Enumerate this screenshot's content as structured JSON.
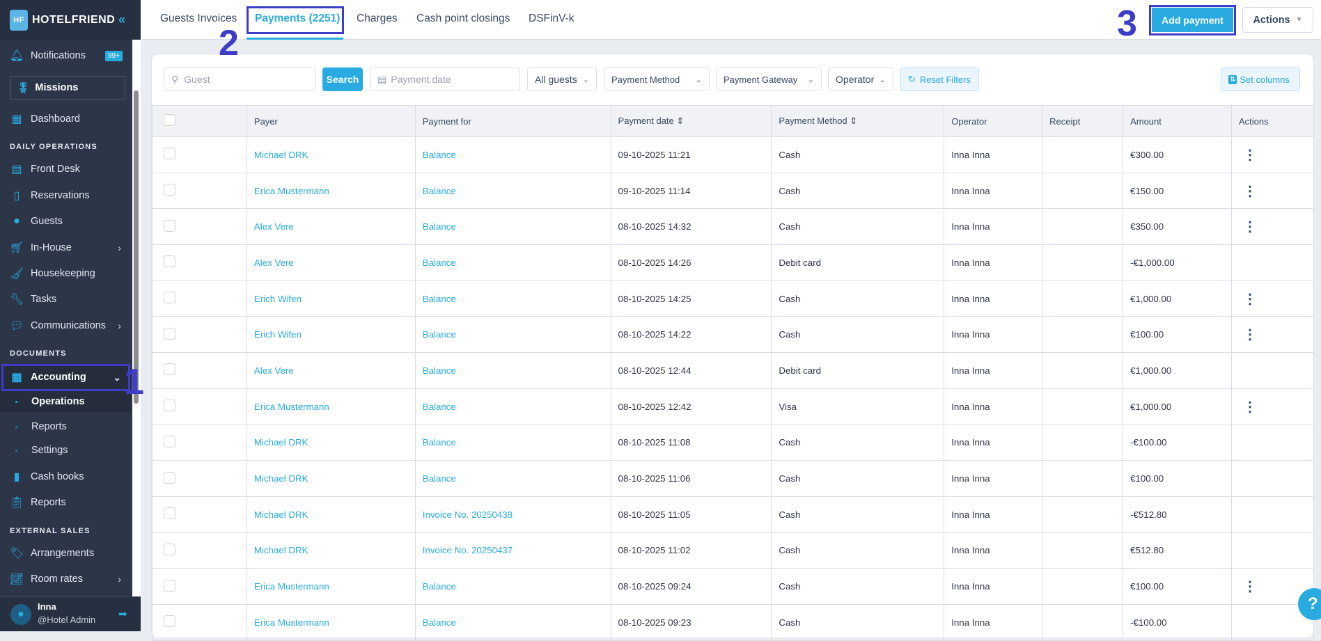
{
  "app": {
    "brand": "HOTELFRIEND",
    "logo_letters": "HF"
  },
  "sidebar": {
    "notifications": "Notifications",
    "notif_badge": "99+",
    "missions": "Missions",
    "dashboard": "Dashboard",
    "section_daily": "DAILY OPERATIONS",
    "daily": [
      "Front Desk",
      "Reservations",
      "Guests",
      "In-House",
      "Housekeeping",
      "Tasks",
      "Communications"
    ],
    "section_documents": "DOCUMENTS",
    "accounting": "Accounting",
    "accounting_sub": [
      "Operations",
      "Reports",
      "Settings"
    ],
    "docs": [
      "Cash books",
      "Reports"
    ],
    "section_external": "EXTERNAL SALES",
    "external": [
      "Arrangements",
      "Room rates"
    ],
    "user": {
      "name": "Inna",
      "role": "@Hotel Admin"
    }
  },
  "annotations": [
    "1",
    "2",
    "3"
  ],
  "tabs": [
    "Guests Invoices",
    "Payments (2251)",
    "Charges",
    "Cash point closings",
    "DSFinV-k"
  ],
  "toolbar": {
    "add_payment": "Add payment",
    "actions": "Actions"
  },
  "filters": {
    "guest_placeholder": "Guest",
    "search": "Search",
    "date_placeholder": "Payment date",
    "all_guests": "All guests",
    "payment_method": "Payment Method",
    "payment_gateway": "Payment Gateway",
    "operator": "Operator",
    "reset": "Reset Filters",
    "set_columns": "Set columns"
  },
  "table": {
    "headers": [
      "Payer",
      "Payment for",
      "Payment date",
      "Payment Method",
      "Operator",
      "Receipt",
      "Amount",
      "Actions"
    ],
    "rows": [
      {
        "payer": "Michael DRK",
        "for": "Balance",
        "date": "09-10-2025 11:21",
        "method": "Cash",
        "operator": "Inna Inna",
        "amount": "€300.00",
        "menu": true
      },
      {
        "payer": "Erica Mustermann",
        "for": "Balance",
        "date": "09-10-2025 11:14",
        "method": "Cash",
        "operator": "Inna Inna",
        "amount": "€150.00",
        "menu": true
      },
      {
        "payer": "Alex Vere",
        "for": "Balance",
        "date": "08-10-2025 14:32",
        "method": "Cash",
        "operator": "Inna Inna",
        "amount": "€350.00",
        "menu": true
      },
      {
        "payer": "Alex Vere",
        "for": "Balance",
        "date": "08-10-2025 14:26",
        "method": "Debit card",
        "operator": "Inna Inna",
        "amount": "-€1,000.00",
        "menu": false
      },
      {
        "payer": "Erich Wifen",
        "for": "Balance",
        "date": "08-10-2025 14:25",
        "method": "Cash",
        "operator": "Inna Inna",
        "amount": "€1,000.00",
        "menu": true
      },
      {
        "payer": "Erich Wifen",
        "for": "Balance",
        "date": "08-10-2025 14:22",
        "method": "Cash",
        "operator": "Inna Inna",
        "amount": "€100.00",
        "menu": true
      },
      {
        "payer": "Alex Vere",
        "for": "Balance",
        "date": "08-10-2025 12:44",
        "method": "Debit card",
        "operator": "Inna Inna",
        "amount": "€1,000.00",
        "menu": false
      },
      {
        "payer": "Erica Mustermann",
        "for": "Balance",
        "date": "08-10-2025 12:42",
        "method": "Visa",
        "operator": "Inna Inna",
        "amount": "€1,000.00",
        "menu": true
      },
      {
        "payer": "Michael DRK",
        "for": "Balance",
        "date": "08-10-2025 11:08",
        "method": "Cash",
        "operator": "Inna Inna",
        "amount": "-€100.00",
        "menu": false
      },
      {
        "payer": "Michael DRK",
        "for": "Balance",
        "date": "08-10-2025 11:06",
        "method": "Cash",
        "operator": "Inna Inna",
        "amount": "€100.00",
        "menu": false
      },
      {
        "payer": "Michael DRK",
        "for": "Invoice No. 20250438",
        "date": "08-10-2025 11:05",
        "method": "Cash",
        "operator": "Inna Inna",
        "amount": "-€512.80",
        "menu": false
      },
      {
        "payer": "Michael DRK",
        "for": "Invoice No. 20250437",
        "date": "08-10-2025 11:02",
        "method": "Cash",
        "operator": "Inna Inna",
        "amount": "€512.80",
        "menu": false
      },
      {
        "payer": "Erica Mustermann",
        "for": "Balance",
        "date": "08-10-2025 09:24",
        "method": "Cash",
        "operator": "Inna Inna",
        "amount": "€100.00",
        "menu": true
      },
      {
        "payer": "Erica Mustermann",
        "for": "Balance",
        "date": "08-10-2025 09:23",
        "method": "Cash",
        "operator": "Inna Inna",
        "amount": "-€100.00",
        "menu": false
      }
    ]
  },
  "help": "?"
}
